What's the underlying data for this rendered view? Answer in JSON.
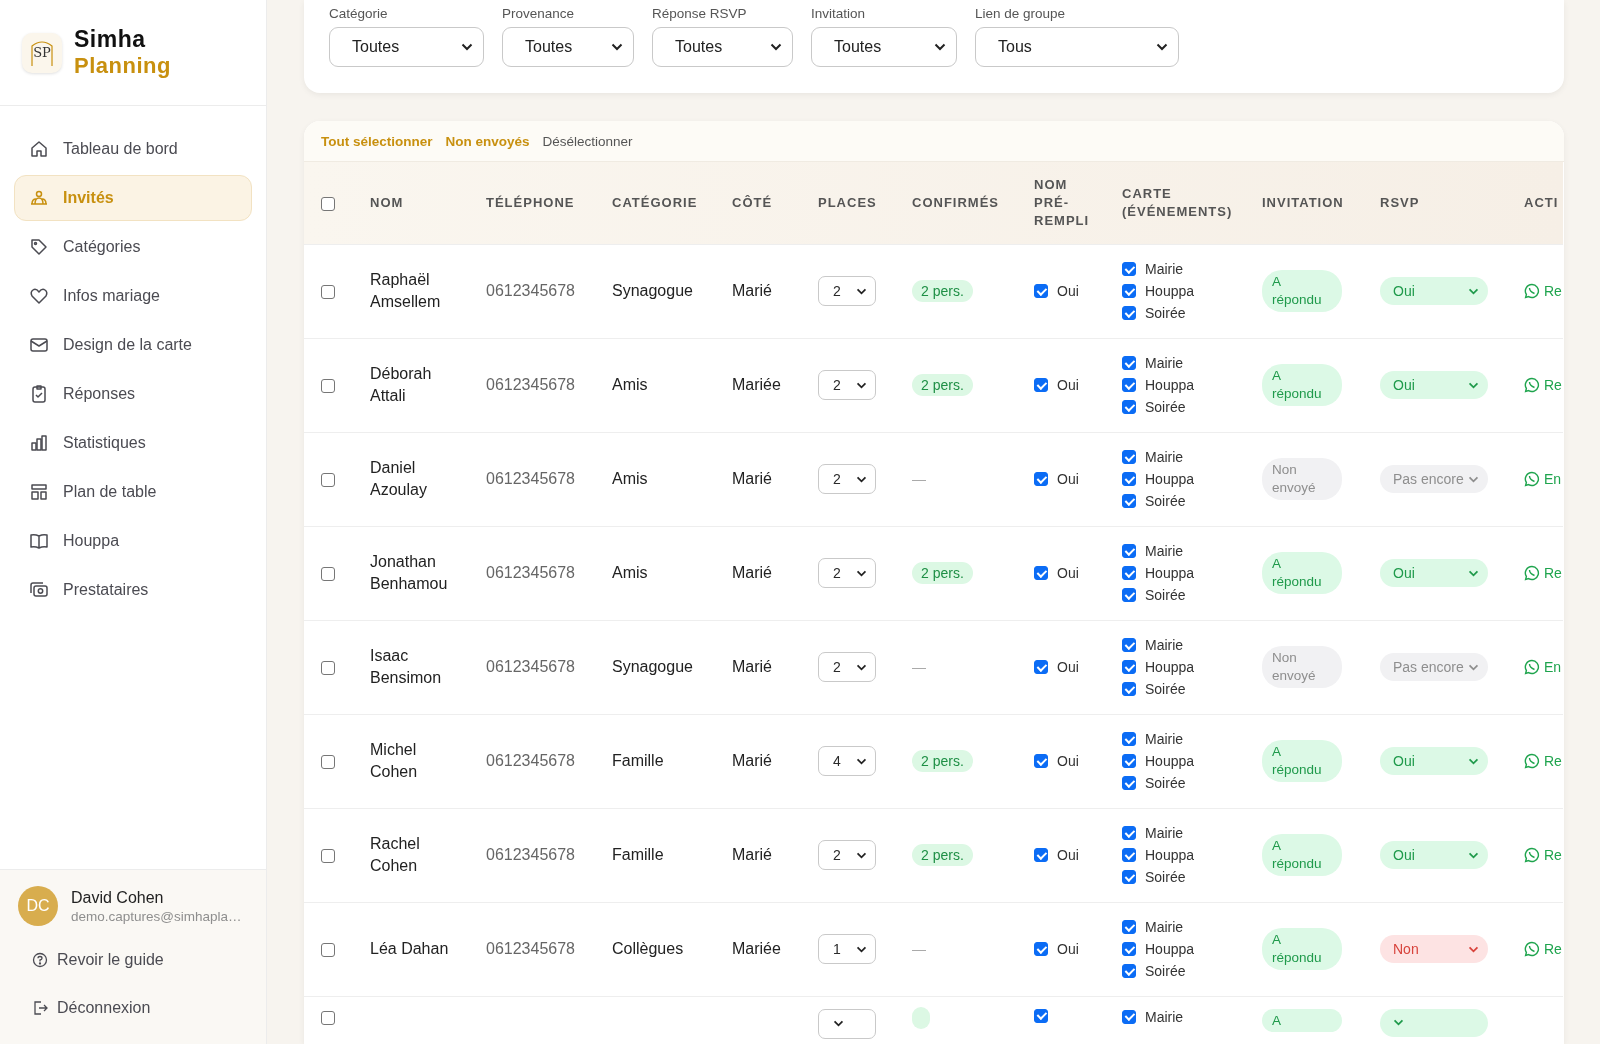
{
  "brand": {
    "line1": "Simha",
    "line2": "Planning",
    "logo_text": "SP"
  },
  "nav": [
    {
      "label": "Tableau de bord",
      "selected": false
    },
    {
      "label": "Invités",
      "selected": true
    },
    {
      "label": "Catégories",
      "selected": false
    },
    {
      "label": "Infos mariage",
      "selected": false
    },
    {
      "label": "Design de la carte",
      "selected": false
    },
    {
      "label": "Réponses",
      "selected": false
    },
    {
      "label": "Statistiques",
      "selected": false
    },
    {
      "label": "Plan de table",
      "selected": false
    },
    {
      "label": "Houppa",
      "selected": false
    },
    {
      "label": "Prestataires",
      "selected": false
    }
  ],
  "user": {
    "initials": "DC",
    "name": "David Cohen",
    "email": "demo.captures@simhapla…"
  },
  "footer_links": [
    "Revoir le guide",
    "Déconnexion"
  ],
  "filters": [
    {
      "label": "Catégorie",
      "value": "Toutes"
    },
    {
      "label": "Provenance",
      "value": "Toutes"
    },
    {
      "label": "Réponse RSVP",
      "value": "Toutes"
    },
    {
      "label": "Invitation",
      "value": "Toutes"
    },
    {
      "label": "Lien de groupe",
      "value": "Tous"
    }
  ],
  "toolbar": [
    {
      "label": "Tout sélectionner",
      "kind": "accent"
    },
    {
      "label": "Non envoyés",
      "kind": "accent"
    },
    {
      "label": "Désélectionner",
      "kind": "plain"
    }
  ],
  "table": {
    "select_all": {
      "checked": false
    },
    "columns": [
      "NOM",
      "TÉLÉPHONE",
      "CATÉGORIE",
      "CÔTÉ",
      "PLACES",
      "CONFIRMÉS",
      "NOM PRÉ-REMPLI",
      "CARTE (ÉVÉNEMENTS)",
      "INVITATION",
      "RSVP",
      "ACTI"
    ],
    "rows": [
      {
        "selected": false,
        "name": "Raphaël Amsellem",
        "phone": "0612345678",
        "category": "Synagogue",
        "side": "Marié",
        "places": "2",
        "confirmed": {
          "kind": "badge",
          "text": "2 pers."
        },
        "prefilled": {
          "checked": true,
          "label": "Oui"
        },
        "events": [
          {
            "label": "Mairie",
            "checked": true
          },
          {
            "label": "Houppa",
            "checked": true
          },
          {
            "label": "Soirée",
            "checked": true
          }
        ],
        "invitation": {
          "kind": "answered",
          "text": "A répondu"
        },
        "rsvp": {
          "kind": "yes",
          "text": "Oui"
        },
        "action": "Re"
      },
      {
        "selected": false,
        "name": "Déborah Attali",
        "phone": "0612345678",
        "category": "Amis",
        "side": "Mariée",
        "places": "2",
        "confirmed": {
          "kind": "badge",
          "text": "2 pers."
        },
        "prefilled": {
          "checked": true,
          "label": "Oui"
        },
        "events": [
          {
            "label": "Mairie",
            "checked": true
          },
          {
            "label": "Houppa",
            "checked": true
          },
          {
            "label": "Soirée",
            "checked": true
          }
        ],
        "invitation": {
          "kind": "answered",
          "text": "A répondu"
        },
        "rsvp": {
          "kind": "yes",
          "text": "Oui"
        },
        "action": "Re"
      },
      {
        "selected": false,
        "name": "Daniel Azoulay",
        "phone": "0612345678",
        "category": "Amis",
        "side": "Marié",
        "places": "2",
        "confirmed": {
          "kind": "none",
          "text": "—"
        },
        "prefilled": {
          "checked": true,
          "label": "Oui"
        },
        "events": [
          {
            "label": "Mairie",
            "checked": true
          },
          {
            "label": "Houppa",
            "checked": true
          },
          {
            "label": "Soirée",
            "checked": true
          }
        ],
        "invitation": {
          "kind": "not_sent",
          "text": "Non envoyé"
        },
        "rsvp": {
          "kind": "pending",
          "text": "Pas encore"
        },
        "action": "En"
      },
      {
        "selected": false,
        "name": "Jonathan Benhamou",
        "phone": "0612345678",
        "category": "Amis",
        "side": "Marié",
        "places": "2",
        "confirmed": {
          "kind": "badge",
          "text": "2 pers."
        },
        "prefilled": {
          "checked": true,
          "label": "Oui"
        },
        "events": [
          {
            "label": "Mairie",
            "checked": true
          },
          {
            "label": "Houppa",
            "checked": true
          },
          {
            "label": "Soirée",
            "checked": true
          }
        ],
        "invitation": {
          "kind": "answered",
          "text": "A répondu"
        },
        "rsvp": {
          "kind": "yes",
          "text": "Oui"
        },
        "action": "Re"
      },
      {
        "selected": false,
        "name": "Isaac Bensimon",
        "phone": "0612345678",
        "category": "Synagogue",
        "side": "Marié",
        "places": "2",
        "confirmed": {
          "kind": "none",
          "text": "—"
        },
        "prefilled": {
          "checked": true,
          "label": "Oui"
        },
        "events": [
          {
            "label": "Mairie",
            "checked": true
          },
          {
            "label": "Houppa",
            "checked": true
          },
          {
            "label": "Soirée",
            "checked": true
          }
        ],
        "invitation": {
          "kind": "not_sent",
          "text": "Non envoyé"
        },
        "rsvp": {
          "kind": "pending",
          "text": "Pas encore"
        },
        "action": "En"
      },
      {
        "selected": false,
        "name": "Michel Cohen",
        "phone": "0612345678",
        "category": "Famille",
        "side": "Marié",
        "places": "4",
        "confirmed": {
          "kind": "badge",
          "text": "2 pers."
        },
        "prefilled": {
          "checked": true,
          "label": "Oui"
        },
        "events": [
          {
            "label": "Mairie",
            "checked": true
          },
          {
            "label": "Houppa",
            "checked": true
          },
          {
            "label": "Soirée",
            "checked": true
          }
        ],
        "invitation": {
          "kind": "answered",
          "text": "A répondu"
        },
        "rsvp": {
          "kind": "yes",
          "text": "Oui"
        },
        "action": "Re"
      },
      {
        "selected": false,
        "name": "Rachel Cohen",
        "phone": "0612345678",
        "category": "Famille",
        "side": "Marié",
        "places": "2",
        "confirmed": {
          "kind": "badge",
          "text": "2 pers."
        },
        "prefilled": {
          "checked": true,
          "label": "Oui"
        },
        "events": [
          {
            "label": "Mairie",
            "checked": true
          },
          {
            "label": "Houppa",
            "checked": true
          },
          {
            "label": "Soirée",
            "checked": true
          }
        ],
        "invitation": {
          "kind": "answered",
          "text": "A répondu"
        },
        "rsvp": {
          "kind": "yes",
          "text": "Oui"
        },
        "action": "Re"
      },
      {
        "selected": false,
        "name": "Léa Dahan",
        "phone": "0612345678",
        "category": "Collègues",
        "side": "Mariée",
        "places": "1",
        "confirmed": {
          "kind": "none",
          "text": "—"
        },
        "prefilled": {
          "checked": true,
          "label": "Oui"
        },
        "events": [
          {
            "label": "Mairie",
            "checked": true
          },
          {
            "label": "Houppa",
            "checked": true
          },
          {
            "label": "Soirée",
            "checked": true
          }
        ],
        "invitation": {
          "kind": "answered",
          "text": "A répondu"
        },
        "rsvp": {
          "kind": "no",
          "text": "Non"
        },
        "action": "Re"
      },
      {
        "selected": false,
        "confirmed": {
          "kind": "badge"
        },
        "prefilled": {
          "checked": true
        },
        "events": [
          {
            "label": "Mairie",
            "checked": true
          }
        ],
        "invitation": {
          "kind": "answered",
          "text": "A"
        },
        "rsvp": {
          "kind": "yes"
        }
      }
    ]
  }
}
